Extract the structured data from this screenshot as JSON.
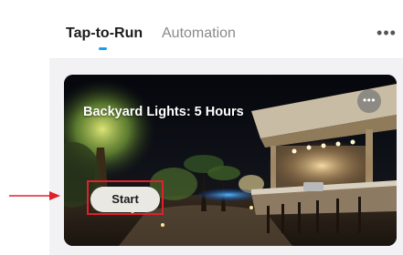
{
  "tabs": [
    {
      "label": "Tap-to-Run",
      "active": true
    },
    {
      "label": "Automation",
      "active": false
    }
  ],
  "header": {
    "more_icon": "more-horizontal-icon",
    "more_glyph": "•••"
  },
  "scene_card": {
    "title": "Backyard Lights: 5 Hours",
    "start_label": "Start",
    "more_icon": "more-horizontal-icon",
    "more_glyph": "•••"
  },
  "annotation": {
    "color": "#e0202b"
  },
  "colors": {
    "accent": "#1aa0e8",
    "panel_bg": "#f2f2f4"
  }
}
